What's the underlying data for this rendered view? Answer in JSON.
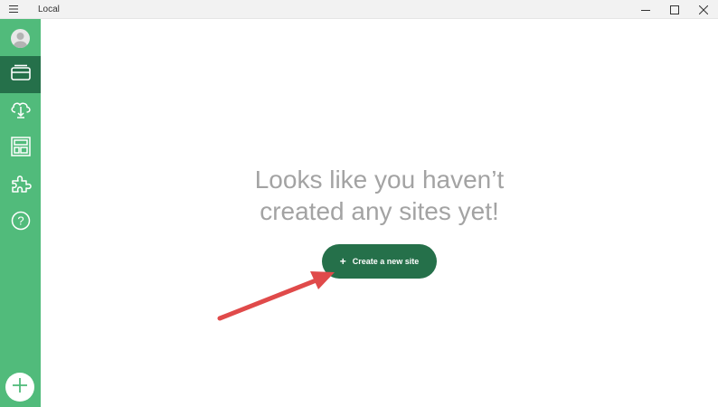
{
  "window": {
    "title": "Local",
    "menu_icon": "hamburger-icon",
    "controls": [
      "minimize-icon",
      "maximize-icon",
      "close-icon"
    ]
  },
  "sidebar": {
    "items": [
      {
        "name": "avatar",
        "icon": "user-avatar-icon"
      },
      {
        "name": "sites",
        "icon": "sites-icon",
        "active": true
      },
      {
        "name": "connect",
        "icon": "cloud-connect-icon"
      },
      {
        "name": "blueprints",
        "icon": "blueprint-layout-icon"
      },
      {
        "name": "addons",
        "icon": "puzzle-icon"
      },
      {
        "name": "help",
        "icon": "help-icon"
      }
    ],
    "add_button_icon": "plus-icon"
  },
  "main": {
    "empty_line1": "Looks like you haven’t",
    "empty_line2": "created any sites yet!",
    "create_button_plus": "+",
    "create_button_label": "Create a new site"
  },
  "colors": {
    "sidebar": "#51bb7b",
    "sidebar_active": "#25704a",
    "button": "#25704a",
    "empty_text": "#a3a3a3",
    "arrow": "#e04a4a"
  }
}
